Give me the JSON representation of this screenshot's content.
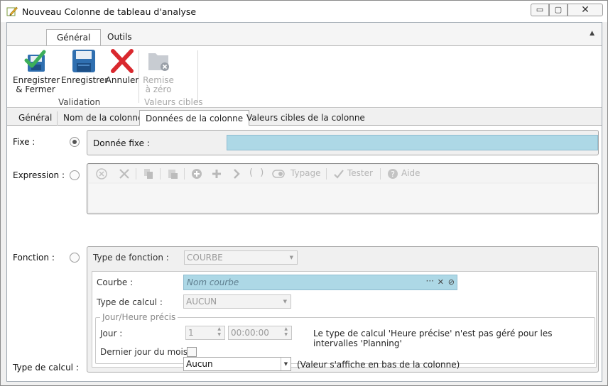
{
  "window": {
    "title": "Nouveau Colonne de tableau d'analyse",
    "minimize_symbol": "▭",
    "maximize_symbol": "▢",
    "close_symbol": "✕"
  },
  "ribbon": {
    "tabs": [
      "Général",
      "Outils"
    ],
    "active_tab": "Général",
    "collapse_symbol": "▲",
    "buttons": [
      {
        "label_line1": "Enregistrer",
        "label_line2": "& Fermer",
        "icon": "save-close-icon",
        "enabled": true
      },
      {
        "label_line1": "Enregistrer",
        "label_line2": "",
        "icon": "save-icon",
        "enabled": true
      },
      {
        "label_line1": "Annuler",
        "label_line2": "",
        "icon": "cancel-icon",
        "enabled": true
      },
      {
        "label_line1": "Remise",
        "label_line2": "à zéro",
        "icon": "folder-reset-icon",
        "enabled": false
      }
    ],
    "groups": [
      "Validation",
      "Valeurs cibles"
    ]
  },
  "section_tabs": [
    "Général",
    "Nom de la colonne",
    "Données de la colonne",
    "Valeurs cibles de la colonne"
  ],
  "active_section_tab": "Données de la colonne",
  "form": {
    "fixe": {
      "label": "Fixe :",
      "selected": true,
      "field_label": "Donnée fixe :",
      "value": ""
    },
    "expression": {
      "label": "Expression :",
      "selected": false,
      "toolbar": [
        "Typage",
        "Tester",
        "Aide"
      ],
      "icons": [
        "clear-icon",
        "delete-icon",
        "copy-icon",
        "paste-icon",
        "add-circle-icon",
        "plus-icon",
        "chevron-right-icon",
        "parentheses-icon",
        "toggle-icon",
        "check-icon",
        "help-icon"
      ]
    },
    "fonction": {
      "label": "Fonction :",
      "selected": false,
      "type_label": "Type de fonction :",
      "type_value": "COURBE",
      "courbe_label": "Courbe :",
      "courbe_placeholder": "Nom courbe",
      "calcul_label": "Type de calcul :",
      "calcul_value": "AUCUN",
      "jour_heure": {
        "legend": "Jour/Heure précis",
        "jour_label": "Jour :",
        "jour_value": "1",
        "heure_value": "00:00:00",
        "note": "Le type de calcul 'Heure précise' n'est pas géré pour les intervalles 'Planning'",
        "dernier_jour_label": "Dernier jour du mois :",
        "dernier_jour_checked": false
      }
    },
    "type_calcul": {
      "label": "Type de calcul :",
      "value": "Aucun",
      "hint": "(Valeur s'affiche en bas de la colonne)"
    }
  },
  "colors": {
    "accent_blue": "#add8e6",
    "save_blue": "#2f6fb0",
    "check_green": "#3cae5a",
    "cancel_red": "#d9282e"
  }
}
